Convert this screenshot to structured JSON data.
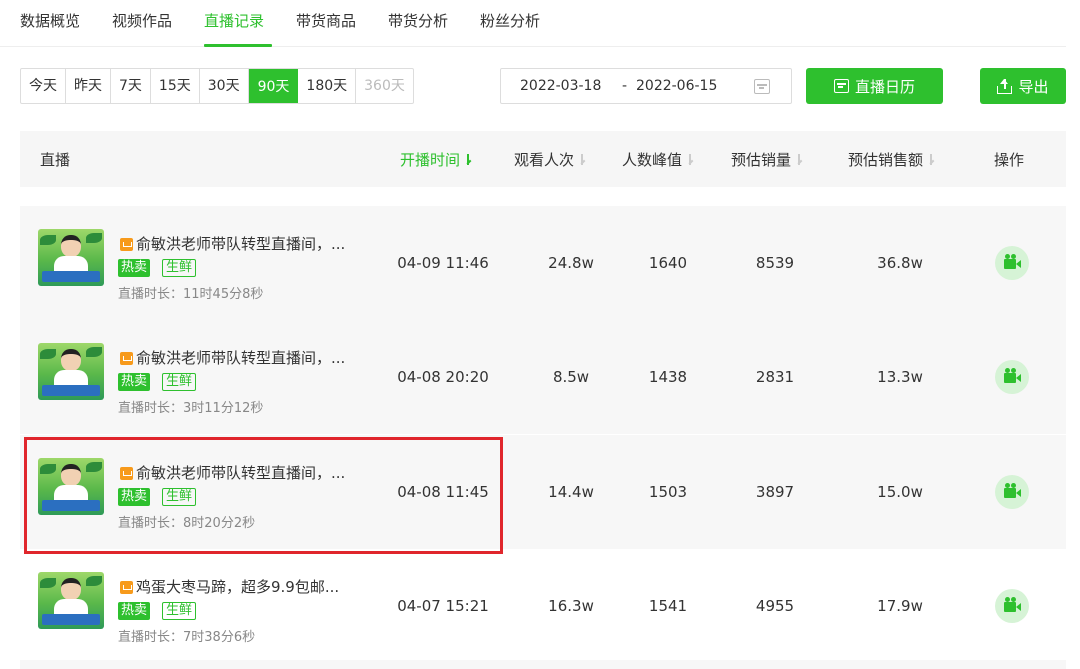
{
  "nav": {
    "tabs": [
      "数据概览",
      "视频作品",
      "直播记录",
      "带货商品",
      "带货分析",
      "粉丝分析"
    ],
    "active_index": 2
  },
  "filters": {
    "ranges": [
      "今天",
      "昨天",
      "7天",
      "15天",
      "30天",
      "90天",
      "180天",
      "360天"
    ],
    "active": "90天",
    "disabled": "360天",
    "date_start": "2022-03-18",
    "date_sep": "-",
    "date_end": "2022-06-15",
    "calendar_button": "直播日历",
    "export_button": "导出"
  },
  "table": {
    "headers": {
      "live": "直播",
      "start_time": "开播时间",
      "views": "观看人次",
      "peak": "人数峰值",
      "est_sales": "预估销量",
      "est_gmv": "预估销售额",
      "action": "操作"
    },
    "rows": [
      {
        "title": "俞敏洪老师带队转型直播间，...",
        "tag_hot": "热卖",
        "tag_fresh": "生鲜",
        "duration": "直播时长：11时45分8秒",
        "start_time": "04-09 11:46",
        "views": "24.8w",
        "peak": "1640",
        "est_sales": "8539",
        "est_gmv": "36.8w"
      },
      {
        "title": "俞敏洪老师带队转型直播间，...",
        "tag_hot": "热卖",
        "tag_fresh": "生鲜",
        "duration": "直播时长：3时11分12秒",
        "start_time": "04-08 20:20",
        "views": "8.5w",
        "peak": "1438",
        "est_sales": "2831",
        "est_gmv": "13.3w"
      },
      {
        "title": "俞敏洪老师带队转型直播间，...",
        "tag_hot": "热卖",
        "tag_fresh": "生鲜",
        "duration": "直播时长：8时20分2秒",
        "start_time": "04-08 11:45",
        "views": "14.4w",
        "peak": "1503",
        "est_sales": "3897",
        "est_gmv": "15.0w"
      },
      {
        "title": "鸡蛋大枣马蹄，超多9.9包邮...",
        "tag_hot": "热卖",
        "tag_fresh": "生鲜",
        "duration": "直播时长：7时38分6秒",
        "start_time": "04-07 15:21",
        "views": "16.3w",
        "peak": "1541",
        "est_sales": "4955",
        "est_gmv": "17.9w"
      }
    ]
  },
  "colors": {
    "accent": "#2ec02e",
    "highlight": "#e0262c"
  }
}
